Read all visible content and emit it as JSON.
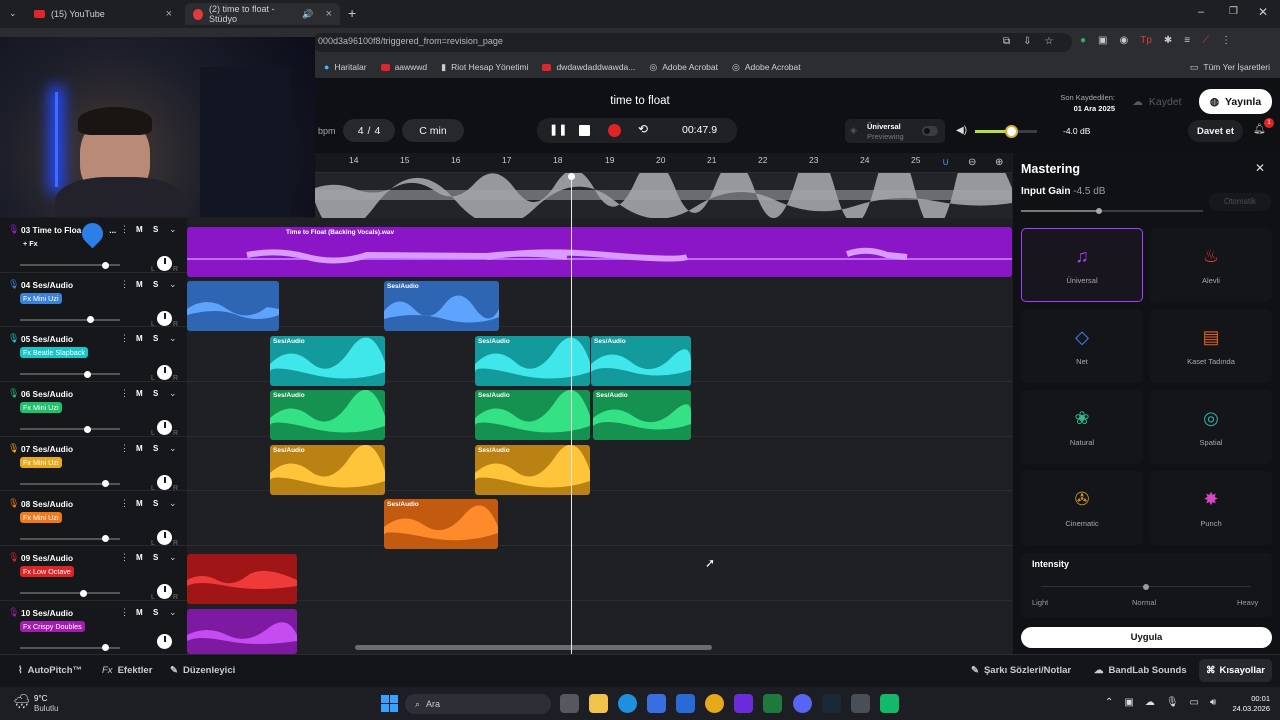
{
  "browser": {
    "tabs": [
      {
        "title": "(15) YouTube",
        "active": false
      },
      {
        "title": "(2) time to float - Stüdyo",
        "active": true
      }
    ],
    "new_tab": "+",
    "url": "000d3a96100f8/triggered_from=revision_page",
    "bookmarks": [
      "Haritalar",
      "aawwwd",
      "Riot Hesap Yönetimi",
      "dwdawdaddwawda...",
      "Adobe Acrobat",
      "Adobe Acrobat"
    ],
    "all_bookmarks": "Tüm Yer İşaretleri"
  },
  "header": {
    "project_title": "time to float",
    "last_saved_label": "Son Kaydedilen:",
    "last_saved_date": "01 Ara 2025",
    "save_label": "Kaydet",
    "publish_label": "Yayınla",
    "invite_label": "Davet et",
    "notif_count": "1",
    "bpm_label": "bpm",
    "time_sig_top": "4",
    "time_sig_sep": "/",
    "time_sig_bottom": "4",
    "key": "C min",
    "time": "00:47.9",
    "master_preset": "Üniversal",
    "master_state": "Previewing",
    "volume_db": "-4.0 dB"
  },
  "ruler": [
    "14",
    "15",
    "16",
    "17",
    "18",
    "19",
    "20",
    "21",
    "22",
    "23",
    "24",
    "25"
  ],
  "tracks": [
    {
      "num": "03",
      "name": "Time to Floa",
      "ellipsis": "...",
      "fx": "+ Fx",
      "color": "#9b1fd8",
      "vol": 0.85
    },
    {
      "num": "04",
      "name": "Ses/Audio",
      "fx": "Fx Mini Uzi",
      "color": "#3b82d6",
      "vol": 0.7
    },
    {
      "num": "05",
      "name": "Ses/Audio",
      "fx": "Fx Beatle Slapback",
      "color": "#17c6c9",
      "vol": 0.67
    },
    {
      "num": "06",
      "name": "Ses/Audio",
      "fx": "Fx Mini Uzi",
      "color": "#1fc06b",
      "vol": 0.67
    },
    {
      "num": "07",
      "name": "Ses/Audio",
      "fx": "Fx Mini Uzi",
      "color": "#e8a81c",
      "vol": 0.85
    },
    {
      "num": "08",
      "name": "Ses/Audio",
      "fx": "Fx Mini Uzi",
      "color": "#ee7a1a",
      "vol": 0.85
    },
    {
      "num": "09",
      "name": "Ses/Audio",
      "fx": "Fx Low Octave",
      "color": "#dc2626",
      "vol": 0.62
    },
    {
      "num": "10",
      "name": "Ses/Audio",
      "fx": "Fx Crispy Doubles",
      "color": "#a21caf",
      "vol": 0.85
    }
  ],
  "track_controls": {
    "mute": "M",
    "solo": "S",
    "left": "L",
    "right": "R"
  },
  "clips": {
    "backing_vocals": "Time to Float (Backing Vocals).wav",
    "audio": "Ses/Audio"
  },
  "mastering": {
    "title": "Mastering",
    "input_gain_label": "Input Gain",
    "input_gain_value": "-4.5 dB",
    "auto_label": "Otomatik",
    "presets": [
      {
        "label": "Üniversal",
        "icon": "music-note-icon",
        "color": "#a042ff"
      },
      {
        "label": "Alevli",
        "icon": "flame-icon",
        "color": "#e83b3b"
      },
      {
        "label": "Net",
        "icon": "diamond-icon",
        "color": "#3b82f6"
      },
      {
        "label": "Kaset Tadında",
        "icon": "cassette-icon",
        "color": "#e2621b"
      },
      {
        "label": "Natural",
        "icon": "lotus-icon",
        "color": "#2fb889"
      },
      {
        "label": "Spatial",
        "icon": "spiral-icon",
        "color": "#2bb3a8"
      },
      {
        "label": "Cinematic",
        "icon": "film-reel-icon",
        "color": "#c9912a"
      },
      {
        "label": "Punch",
        "icon": "burst-icon",
        "color": "#d946c5"
      }
    ],
    "intensity_label": "Intensity",
    "intensity_levels": [
      "Light",
      "Normal",
      "Heavy"
    ],
    "apply_label": "Uygula"
  },
  "bottom_bar": {
    "autopitch": "AutoPitch™",
    "effects": "Efektler",
    "editor": "Düzenleyici",
    "lyrics": "Şarkı Sözleri/Notlar",
    "sounds": "BandLab Sounds",
    "shortcuts": "Kısayollar"
  },
  "taskbar": {
    "weather_temp": "9°C",
    "weather_desc": "Bulutlu",
    "search": "Ara",
    "time": "00:01",
    "date": "24.03.2026"
  }
}
